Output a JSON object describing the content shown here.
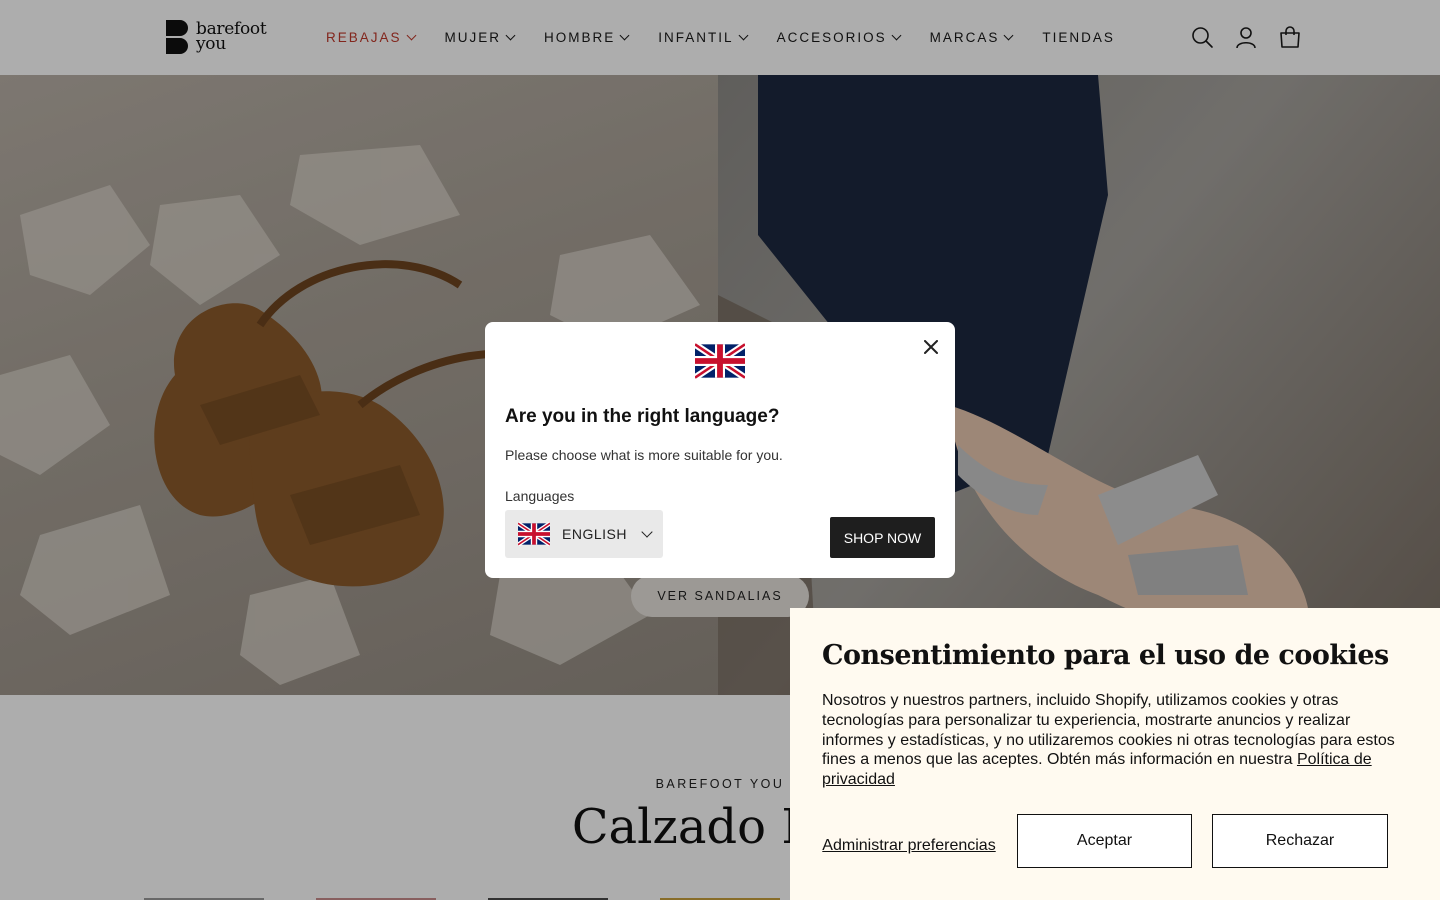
{
  "header": {
    "logo_line1": "barefoot",
    "logo_line2": "you",
    "nav": [
      {
        "label": "REBAJAS",
        "has_dropdown": true,
        "color": "#c0392b"
      },
      {
        "label": "MUJER",
        "has_dropdown": true
      },
      {
        "label": "HOMBRE",
        "has_dropdown": true
      },
      {
        "label": "INFANTIL",
        "has_dropdown": true
      },
      {
        "label": "ACCESORIOS",
        "has_dropdown": true
      },
      {
        "label": "MARCAS",
        "has_dropdown": true
      },
      {
        "label": "TIENDAS",
        "has_dropdown": false
      }
    ],
    "icons": [
      "search-icon",
      "account-icon",
      "cart-icon"
    ]
  },
  "hero": {
    "cta_label": "VER SANDALIAS"
  },
  "section": {
    "eyebrow": "BAREFOOT YOU",
    "title": "Calzado Bar"
  },
  "language_modal": {
    "title": "Are you in the right language?",
    "subtitle": "Please choose what is more suitable for you.",
    "languages_label": "Languages",
    "selected_language": "ENGLISH",
    "shop_button": "SHOP NOW",
    "flag_icon": "uk-flag-icon",
    "close_icon": "close-icon"
  },
  "cookie_banner": {
    "title": "Consentimiento para el uso de cookies",
    "body": "Nosotros y nuestros partners, incluido Shopify, utilizamos cookies y otras tecnologías para personalizar tu experiencia, mostrarte anuncios y realizar informes y estadísticas, y no utilizaremos cookies ni otras tecnologías para estos fines a menos que las aceptes. Obtén más información en nuestra",
    "policy_link": "Política de privacidad",
    "manage_label": "Administrar preferencias",
    "accept_label": "Aceptar",
    "reject_label": "Rechazar",
    "background": "#fffaf0"
  }
}
